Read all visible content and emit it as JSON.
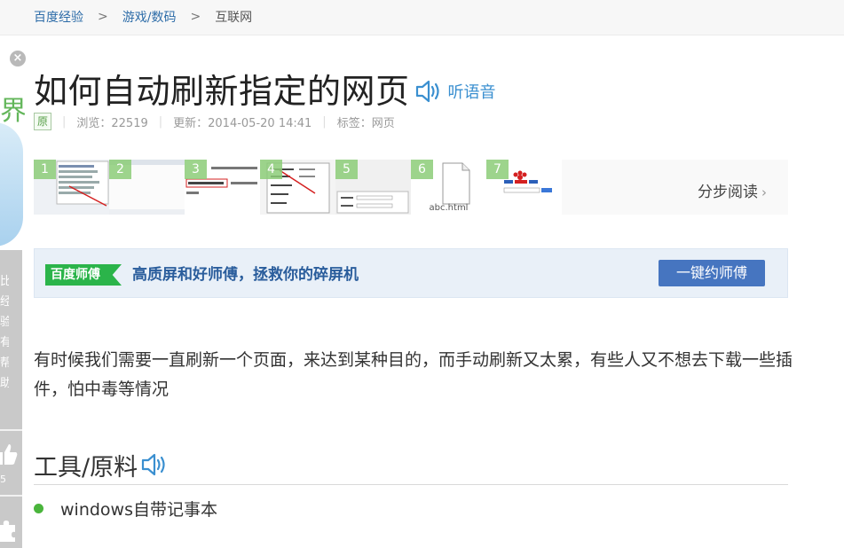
{
  "breadcrumb": [
    {
      "label": "百度经验"
    },
    {
      "label": "游戏/数码"
    },
    {
      "label": "互联网"
    }
  ],
  "breadcrumb_separator": ">",
  "sidebar": {
    "close_glyph": "×",
    "art_text": "界",
    "vertical_text": "比经验有帮助？",
    "like_count": "5"
  },
  "article": {
    "title": "如何自动刷新指定的网页",
    "listen_label": "听语音",
    "original_badge": "原",
    "views": "浏览：22519",
    "updated": "更新：2014-05-20 14:41",
    "tags": "标签：网页"
  },
  "steps": {
    "items": [
      {
        "num": "1",
        "caption": ""
      },
      {
        "num": "2",
        "caption": ""
      },
      {
        "num": "3",
        "caption": ""
      },
      {
        "num": "4",
        "caption": ""
      },
      {
        "num": "5",
        "caption": ""
      },
      {
        "num": "6",
        "caption": "abc.html"
      },
      {
        "num": "7",
        "caption": ""
      }
    ],
    "read_label": "分步阅读",
    "read_chevron": "›"
  },
  "ad": {
    "badge": "百度师傅",
    "slogan": "高质屏和好师傅，拯救你的碎屏机",
    "button": "一键约师傅"
  },
  "intro": "有时候我们需要一直刷新一个页面，来达到某种目的，而手动刷新又太累，有些人又不想去下载一些插件，怕中毒等情况",
  "tools": {
    "heading": "工具/原料",
    "items": [
      "windows自带记事本"
    ]
  },
  "colors": {
    "link": "#2d6ca8",
    "listen": "#3a8fd0",
    "green": "#4ab53c",
    "ad_button": "#4675c0"
  }
}
